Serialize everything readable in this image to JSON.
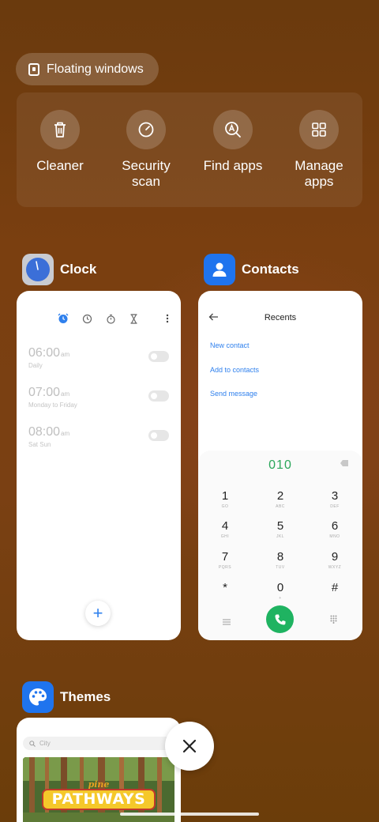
{
  "floating_windows": {
    "label": "Floating windows"
  },
  "quick_actions": [
    {
      "id": "cleaner",
      "label": "Cleaner",
      "icon": "trash-icon"
    },
    {
      "id": "security",
      "label": "Security scan",
      "line1": "Security",
      "line2": "scan",
      "icon": "speedometer-icon"
    },
    {
      "id": "find",
      "label": "Find apps",
      "icon": "search-a-icon"
    },
    {
      "id": "manage",
      "label": "Manage apps",
      "line1": "Manage",
      "line2": "apps",
      "icon": "grid-icon"
    }
  ],
  "apps": {
    "clock": {
      "name": "Clock",
      "tabs": [
        "alarm-icon",
        "clock-icon",
        "stopwatch-icon",
        "timer-icon"
      ],
      "alarms": [
        {
          "time": "06:00",
          "ampm": "am",
          "repeat": "Daily",
          "enabled": false
        },
        {
          "time": "07:00",
          "ampm": "am",
          "repeat": "Monday to Friday",
          "enabled": false
        },
        {
          "time": "08:00",
          "ampm": "am",
          "repeat": "Sat Sun",
          "enabled": false
        }
      ],
      "add_label": "+"
    },
    "contacts": {
      "name": "Contacts",
      "title": "Recents",
      "links": [
        "New contact",
        "Add to contacts",
        "Send message"
      ],
      "dialed": "010",
      "keys": [
        {
          "d": "1",
          "l": "GO"
        },
        {
          "d": "2",
          "l": "ABC"
        },
        {
          "d": "3",
          "l": "DEF"
        },
        {
          "d": "4",
          "l": "GHI"
        },
        {
          "d": "5",
          "l": "JKL"
        },
        {
          "d": "6",
          "l": "MNO"
        },
        {
          "d": "7",
          "l": "PQRS"
        },
        {
          "d": "8",
          "l": "TUV"
        },
        {
          "d": "9",
          "l": "WXYZ"
        },
        {
          "d": "*",
          "l": ""
        },
        {
          "d": "0",
          "l": "+"
        },
        {
          "d": "#",
          "l": ""
        }
      ]
    },
    "themes": {
      "name": "Themes",
      "search_placeholder": "City",
      "banner_top": "pine",
      "banner_main": "PATHWAYS"
    }
  },
  "colors": {
    "accent_blue": "#2f80ed",
    "call_green": "#1fb361",
    "dial_green": "#2aa65a"
  }
}
